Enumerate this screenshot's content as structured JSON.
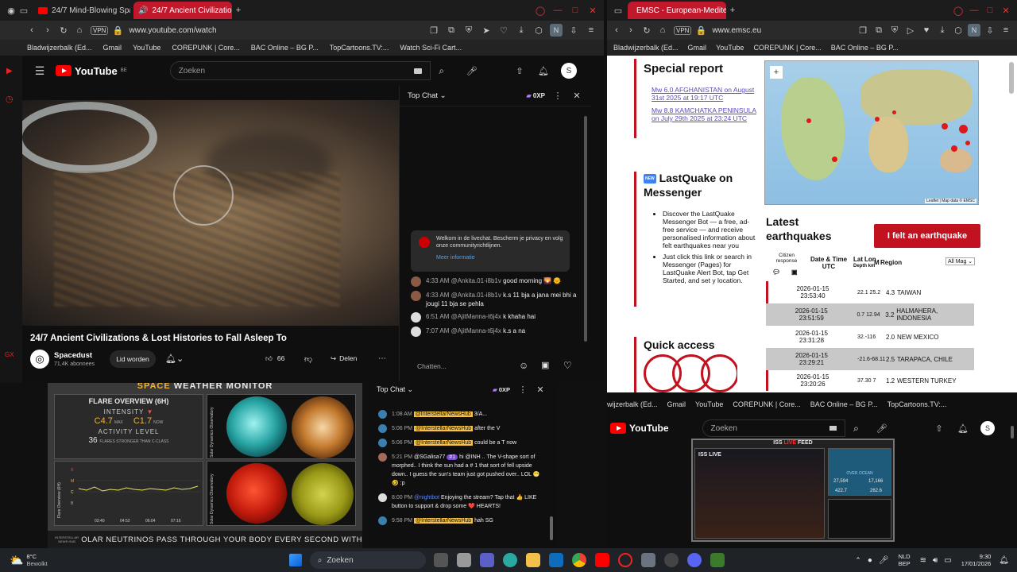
{
  "left_browser": {
    "tabs": [
      {
        "label": "24/7 Mind-Blowing Space"
      },
      {
        "label": "24/7 Ancient Civilizatio"
      }
    ],
    "url": "www.youtube.com/watch",
    "vpn": "VPN",
    "bookmarks": [
      "Bladwijzerbalk (Ed...",
      "Gmail",
      "YouTube",
      "COREPUNK | Core...",
      "BAC Online – BG P...",
      "TopCartoons.TV:...",
      "Watch Sci-Fi Cart..."
    ]
  },
  "yt_main": {
    "logo_suffix": "BE",
    "search_placeholder": "Zoeken",
    "avatar": "S",
    "video_title": "24/7 Ancient Civilizations & Lost Histories to Fall Asleep To",
    "channel_name": "Spacedust",
    "subscribers": "71,4K abonnees",
    "join_label": "Lid worden",
    "likes": "66",
    "share_label": "Delen"
  },
  "chat_main": {
    "header": "Top Chat",
    "badge": "0XP",
    "welcome": "Welkom in de livechat. Bescherm je privacy en volg onze communityrichtlijnen.",
    "more_info": "Meer informatie",
    "messages": [
      {
        "time": "4:33 AM",
        "user": "@Ankita.01-i8b1v",
        "text": "good morning 🌄 🌞"
      },
      {
        "time": "4:33 AM",
        "user": "@Ankita.01-i8b1v",
        "text": "k.s 11 bja a jana mei bhi a jougi 11 bja se pehla"
      },
      {
        "time": "6:51 AM",
        "user": "@AjitManna-t6j4x",
        "text": "k khaha hai"
      },
      {
        "time": "7:07 AM",
        "user": "@AjitManna-t6j4x",
        "text": "k.s a na"
      }
    ],
    "input_placeholder": "Chatten..."
  },
  "space_weather": {
    "title_space": "SPACE",
    "title_rest": "WEATHER MONITOR",
    "overview_title": "FLARE OVERVIEW (6H)",
    "intensity_label": "INTENSITY",
    "max_value": "C4.7",
    "max_label": "MAX",
    "now_value": "C1.7",
    "now_label": "NOW",
    "activity_label": "ACTIVITY LEVEL",
    "activity_count": "36",
    "activity_desc": "FLARES STRONGER THAN C-CLASS",
    "sdo_label": "Solar Dynamics Observatory",
    "flare_axis_label": "Flare Overview (6H)",
    "flare_levels": [
      "X",
      "M",
      "C",
      "B"
    ],
    "chart_times": [
      "03:40",
      "04:52",
      "06:04",
      "07:16"
    ],
    "ticker": "OLAR NEUTRINOS PASS THROUGH YOUR BODY EVERY SECOND WITH",
    "news_logo": "INTERSTELLAR NEWS HUB"
  },
  "chat2": {
    "header": "Top Chat",
    "badge": "0XP",
    "messages": [
      {
        "time": "1:08 AM",
        "user": "@InterstellarNewsHub",
        "text": "3/A..."
      },
      {
        "time": "5:06 PM",
        "user": "@InterstellarNewsHub",
        "text": "after the V"
      },
      {
        "time": "5:06 PM",
        "user": "@InterstellarNewsHub",
        "text": "could be a T now"
      },
      {
        "time": "5:21 PM",
        "user": "@SGalisa77",
        "text": "hi @INH .. The V-shape sort of morphed.. I think the sun had a # 1 that sort of fell upside down.. I guess the sun's team just got pushed over.. LOL 😁🤣 :p",
        "badge": "#1"
      },
      {
        "time": "8:00 PM",
        "user": "@nightbot",
        "text": "Enjoying the stream? Tap that 👍 LIKE button to support & drop some ❤️ HEARTS!"
      },
      {
        "time": "9:58 PM",
        "user": "@InterstellarNewsHub",
        "text": "hah SG"
      }
    ]
  },
  "right_browser": {
    "tab": "EMSC - European-Mediter",
    "url": "www.emsc.eu",
    "vpn": "VPN",
    "bookmarks": [
      "Bladwijzerbalk (Ed...",
      "Gmail",
      "YouTube",
      "COREPUNK | Core...",
      "BAC Online – BG P..."
    ]
  },
  "emsc": {
    "special_title": "Special report",
    "special_links": [
      "Mw 6.0 AFGHANISTAN on August 31st 2025 at 19:17 UTC",
      "Mw 8.8 KAMCHATKA PENINSULA on July 29th 2025 at 23:24 UTC"
    ],
    "new_badge": "NEW",
    "lastquake_title": "LastQuake on Messenger",
    "lastquake_bullets": [
      "Discover the LastQuake Messenger Bot — a free, ad-free service — and receive personalised information about felt earthquakes near you",
      "Just click this link or search in Messenger (Pages) for LastQuake Alert Bot, tap Get Started, and set y location."
    ],
    "quick_title": "Quick access",
    "map_attrib": "Leaflet | Map data © EMSC",
    "latest_title": "Latest earthquakes",
    "felt_button": "I felt an earthquake",
    "table_headers": [
      "Citizen response",
      "Date & Time UTC",
      "Lat",
      "Lon",
      "Depth km",
      "M",
      "Region"
    ],
    "filter": "All Mag",
    "quakes": [
      {
        "date": "2026-01-15",
        "time": "23:53:40",
        "vals": "22.1 25.2",
        "mag": "4.3",
        "region": "TAIWAN"
      },
      {
        "date": "2026-01-15",
        "time": "23:51:59",
        "vals": "0.7 12.94",
        "mag": "3.2",
        "region": "HALMAHERA, INDONESIA"
      },
      {
        "date": "2026-01-15",
        "time": "23:31:28",
        "vals": "32.-116",
        "mag": "2.0",
        "region": "NEW MEXICO"
      },
      {
        "date": "2026-01-15",
        "time": "23:29:21",
        "vals": "-21.6-68.11",
        "mag": "2.5",
        "region": "TARAPACA, CHILE"
      },
      {
        "date": "2026-01-15",
        "time": "23:20:26",
        "vals": "37.30 7",
        "mag": "1.2",
        "region": "WESTERN TURKEY"
      }
    ]
  },
  "iss_window": {
    "bookmarks": [
      "wijzerbalk (Ed...",
      "Gmail",
      "YouTube",
      "COREPUNK | Core...",
      "BAC Online – BG P...",
      "TopCartoons.TV:..."
    ],
    "search_placeholder": "Zoeken",
    "avatar": "S",
    "header_left": "ISS ",
    "header_live": "LIVE",
    "header_right": " FEED",
    "live_badge": "ISS LIVE",
    "over_label": "OVER OCEAN",
    "stats": [
      "27,594",
      "17,166",
      "422.7",
      "262.6"
    ]
  },
  "taskbar": {
    "temp": "8°C",
    "weather": "Bewolkt",
    "search": "Zoeken",
    "lang": "NLD",
    "lang2": "BEP",
    "time": "9:30",
    "date": "17/01/2026"
  },
  "colors": {
    "yt_red": "#ff0000",
    "emsc_red": "#c2121f",
    "chat_highlight": "#f6c244"
  }
}
